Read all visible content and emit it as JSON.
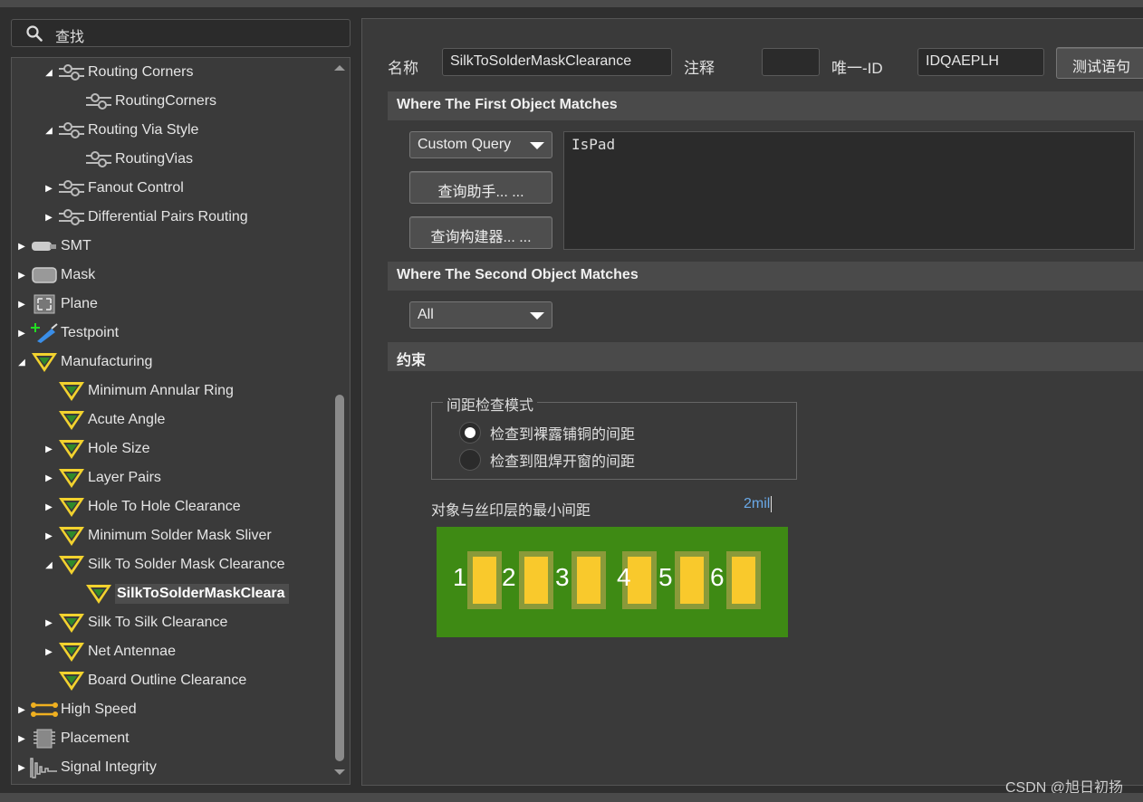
{
  "search": {
    "label": "查找"
  },
  "tree": {
    "items": [
      {
        "label": "Routing Corners",
        "arrow": "▲",
        "icon": "routing-icon"
      },
      {
        "label": "RoutingCorners",
        "arrow": "",
        "icon": "routing-icon"
      },
      {
        "label": "Routing Via Style",
        "arrow": "▲",
        "icon": "routing-icon"
      },
      {
        "label": "RoutingVias",
        "arrow": "",
        "icon": "routing-icon"
      },
      {
        "label": "Fanout Control",
        "arrow": "▶",
        "icon": "routing-icon"
      },
      {
        "label": "Differential Pairs Routing",
        "arrow": "▶",
        "icon": "routing-icon"
      },
      {
        "label": "SMT",
        "arrow": "▶",
        "icon": "smt-icon"
      },
      {
        "label": "Mask",
        "arrow": "▶",
        "icon": "mask-icon"
      },
      {
        "label": "Plane",
        "arrow": "▶",
        "icon": "plane-icon"
      },
      {
        "label": "Testpoint",
        "arrow": "▶",
        "icon": "testpoint-icon"
      },
      {
        "label": "Manufacturing",
        "arrow": "▲",
        "icon": "manufacturing-icon"
      },
      {
        "label": "Minimum Annular Ring",
        "arrow": "",
        "icon": "manufacturing-icon"
      },
      {
        "label": "Acute Angle",
        "arrow": "",
        "icon": "manufacturing-icon"
      },
      {
        "label": "Hole Size",
        "arrow": "▶",
        "icon": "manufacturing-icon"
      },
      {
        "label": "Layer Pairs",
        "arrow": "▶",
        "icon": "manufacturing-icon"
      },
      {
        "label": "Hole To Hole Clearance",
        "arrow": "▶",
        "icon": "manufacturing-icon"
      },
      {
        "label": "Minimum Solder Mask Sliver",
        "arrow": "▶",
        "icon": "manufacturing-icon"
      },
      {
        "label": "Silk To Solder Mask Clearance",
        "arrow": "▲",
        "icon": "manufacturing-icon"
      },
      {
        "label": "SilkToSolderMaskCleara",
        "arrow": "",
        "icon": "manufacturing-icon"
      },
      {
        "label": "Silk To Silk Clearance",
        "arrow": "▶",
        "icon": "manufacturing-icon"
      },
      {
        "label": "Net Antennae",
        "arrow": "▶",
        "icon": "manufacturing-icon"
      },
      {
        "label": "Board Outline Clearance",
        "arrow": "",
        "icon": "manufacturing-icon"
      },
      {
        "label": "High Speed",
        "arrow": "▶",
        "icon": "high-speed-icon"
      },
      {
        "label": "Placement",
        "arrow": "▶",
        "icon": "placement-icon"
      },
      {
        "label": "Signal Integrity",
        "arrow": "▶",
        "icon": "signal-integrity-icon"
      }
    ]
  },
  "form": {
    "name_label": "名称",
    "name_value": "SilkToSolderMaskClearance",
    "comment_label": "注释",
    "comment_value": "",
    "id_label": "唯一-ID",
    "id_value": "IDQAEPLH",
    "test_button": "测试语句"
  },
  "first_match": {
    "title": "Where The First Object Matches",
    "dropdown": "Custom Query",
    "helper_button": "查询助手... ...",
    "builder_button": "查询构建器... ...",
    "query_text": "IsPad"
  },
  "second_match": {
    "title": "Where The Second Object Matches",
    "dropdown": "All"
  },
  "constraints": {
    "title": "约束",
    "mode_group_title": "间距检查模式",
    "radio_1": "检查到裸露铺铜的间距",
    "radio_2": "检查到阻焊开窗的间距",
    "selected_radio": 1,
    "min_clearance_label": "对象与丝印层的最小间距",
    "min_clearance_value": "2mil",
    "pads": [
      "1",
      "2",
      "3",
      "4",
      "5",
      "6"
    ]
  },
  "colors": {
    "pcb_green": "#3e8a14",
    "pad_yellow": "#f9c92c",
    "value_blue": "#6aa9e8"
  },
  "watermark": "CSDN @旭日初扬"
}
